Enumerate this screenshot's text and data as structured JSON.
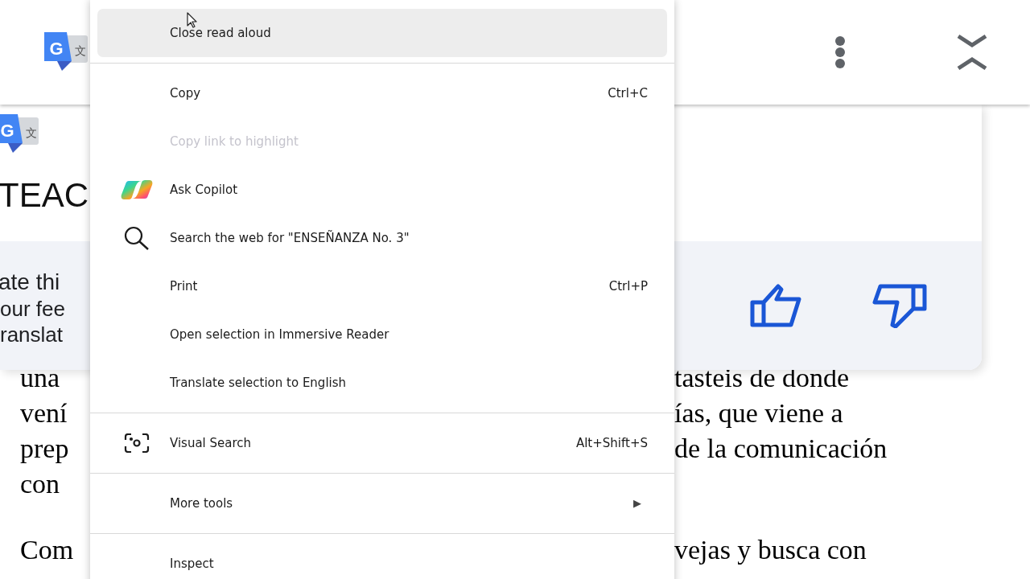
{
  "translate_panel": {
    "header": {
      "logo": {
        "letter": "G",
        "glyph": "文"
      }
    },
    "card": {
      "logo": {
        "letter": "G",
        "glyph": "文"
      },
      "title_fragment": "TEAC",
      "feedback_lines": [
        "ate thi",
        "our fee",
        "ranslat"
      ]
    }
  },
  "document": {
    "paragraphs": [
      {
        "lines": [
          {
            "left": "una",
            "right": "tasteis de donde"
          },
          {
            "left": "vení",
            "right": "ías, que viene a"
          },
          {
            "left": "prep",
            "right": "de la comunicación"
          },
          {
            "left": "con"
          }
        ]
      },
      {
        "lines": [
          {
            "left": "Com",
            "right": "vejas y busca con"
          }
        ]
      }
    ]
  },
  "context_menu": {
    "items": [
      {
        "kind": "plain",
        "label": "Close read aloud",
        "selected": true,
        "disabled": false
      },
      {
        "kind": "divider"
      },
      {
        "kind": "plain",
        "label": "Copy",
        "shortcut": "Ctrl+C",
        "selected": false,
        "disabled": false
      },
      {
        "kind": "plain",
        "label": "Copy link to highlight",
        "selected": false,
        "disabled": true
      },
      {
        "kind": "copilot",
        "label": "Ask Copilot",
        "selected": false,
        "disabled": false
      },
      {
        "kind": "search",
        "label": "Search the web for \"ENSEÑANZA No. 3\"",
        "selected": false,
        "disabled": false
      },
      {
        "kind": "plain",
        "label": "Print",
        "shortcut": "Ctrl+P",
        "selected": false,
        "disabled": false
      },
      {
        "kind": "plain",
        "label": "Open selection in Immersive Reader",
        "selected": false,
        "disabled": false
      },
      {
        "kind": "plain",
        "label": "Translate selection to English",
        "selected": false,
        "disabled": false
      },
      {
        "kind": "divider"
      },
      {
        "kind": "lens",
        "label": "Visual Search",
        "shortcut": "Alt+Shift+S",
        "selected": false,
        "disabled": false
      },
      {
        "kind": "divider"
      },
      {
        "kind": "plain",
        "label": "More tools",
        "submenu_arrow": "▶",
        "selected": false,
        "disabled": false
      },
      {
        "kind": "divider"
      },
      {
        "kind": "plain",
        "label": "Inspect",
        "selected": false,
        "disabled": false
      }
    ]
  }
}
